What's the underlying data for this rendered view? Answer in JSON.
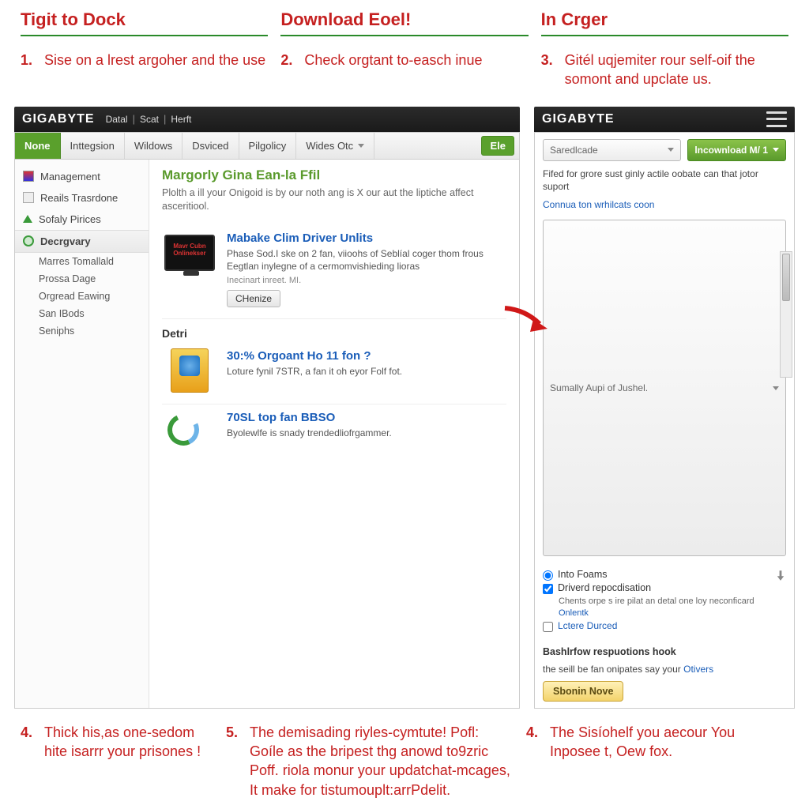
{
  "headings": {
    "h1": "Tigit to Dock",
    "h2": "Download Eoel!",
    "h3": "In Crger"
  },
  "steps_top": {
    "s1": {
      "num": "1.",
      "txt": "Sise on a lrest argoher and the use"
    },
    "s2": {
      "num": "2.",
      "txt": "Check orgtant to-easch inue"
    },
    "s3": {
      "num": "3.",
      "txt": "Gitél uqjemiter rour self-oif the somont and upclate us."
    }
  },
  "left": {
    "brand": "GIGABYTE",
    "top_links": [
      "Datal",
      "Scat",
      "Herft"
    ],
    "tabs": [
      "None",
      "Inttegsion",
      "Wildows",
      "Dsviced",
      "Pilgolicy",
      "Wides Otc"
    ],
    "el_btn": "Ele",
    "sidebar": {
      "items": [
        "Management",
        "Reails Trasrdone",
        "Sofaly Pirices"
      ],
      "active": "Decrgvary",
      "subs": [
        "Marres Tomallald",
        "Prossa Dage",
        "Orgread Eawing",
        "San IBods",
        "Seniphs"
      ]
    },
    "content": {
      "title": "Margorly Gina Ean-la Ffil",
      "sub": "Plolth a ill your Onigoid is by our noth ang is X our aut the liptiche affect asceritiool.",
      "card1": {
        "title": "Mabake Clim Driver Unlits",
        "desc": "Phase Sod.I ske on 2 fan, viioohs of Seblíal coger thom frous Eegtlan inylegne of a cermomvishieding lioras",
        "meta": "Inecinart inreet. MI.",
        "btn": "CHenize",
        "thumb_label": "Mavr Cubn Onlinekser"
      },
      "section": "Detri",
      "card2": {
        "title": "30:% Orgoant Ho 11 fon ?",
        "desc": "Loture fynil 7STR, a fan it oh eyor Folf fot."
      },
      "card3": {
        "title": "70SL top fan BBSO",
        "desc": "Byolewlfe is snady trendedliofrgammer."
      }
    }
  },
  "right": {
    "brand": "GIGABYTE",
    "select1": "Saredlcade",
    "dl_btn": "lncownload M/ 1",
    "note": "Fifed for grore sust ginly actile oobate can that jotor suport",
    "link1": "Connua ton wrhilcats coon",
    "select2": "Sumally Aupi of Jushel.",
    "opt1": "Into Foams",
    "opt2": "Driverd repocdisation",
    "opt2_sub": "Chents orpe s ire pilat an detal one loy neconficard",
    "opt2_sublink": "Onlentk",
    "opt3": "Lctere Durced",
    "head2": "Bashlrfow respuotions hook",
    "body2_a": "the seill be fan onipates say your ",
    "body2_link": "Otivers",
    "btn": "Sbonin Nove"
  },
  "steps_bottom": {
    "s4": {
      "num": "4.",
      "txt": "Thick his,as one-sedom hite isarrr your prisones !"
    },
    "s5": {
      "num": "5.",
      "txt": "The demisading riyles-cymtute! Pofl: Goíle as the bripest thg anowd to9zric Poff. riola monur your updatchat-mcages, It make for tistumouplt:arrPdelit."
    },
    "s4b": {
      "num": "4.",
      "txt": "The Sisíohelf you aecour You Inposee t, Oew fox."
    }
  }
}
